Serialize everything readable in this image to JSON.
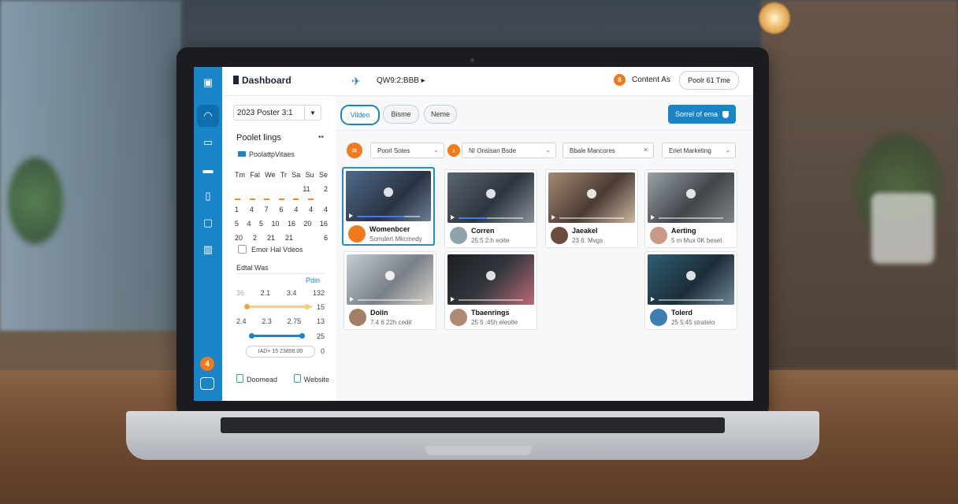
{
  "sidebar_rail": {
    "badge": "4"
  },
  "sidebar": {
    "title": "Dashboard",
    "period": "2023 Poster 3:1",
    "section_title": "Poolet lings",
    "section_more": "••",
    "legend_label": "PoolattpVitaes",
    "calendar": {
      "days": [
        "Tm",
        "Fal",
        "We",
        "Tr",
        "Sa",
        "Su",
        "Se"
      ],
      "rows": [
        [
          "",
          "",
          "",
          "",
          "",
          "11",
          "2"
        ],
        [
          "1",
          "4",
          "7",
          "6",
          "4",
          "4",
          "4"
        ],
        [
          "5",
          "4",
          "5",
          "10",
          "16",
          "20",
          "16"
        ],
        [
          "20",
          "2",
          "21",
          "21",
          "",
          "",
          "6"
        ]
      ]
    },
    "check_label": "Emor Hal Vdeos",
    "filter_title": "Edtal Was",
    "filter_link": "Pdin",
    "range_rows": [
      [
        "36",
        "2.1",
        "3.4",
        "132"
      ],
      [
        "",
        "",
        "",
        "15"
      ],
      [
        "2.4",
        "2.3",
        "2.75",
        "13"
      ],
      [
        "",
        "",
        "",
        "25"
      ]
    ],
    "range_input": "IAD+ 15 23856.00",
    "range_zero": "0",
    "links": [
      "Doomead",
      "Website"
    ]
  },
  "topbar": {
    "crumb": "QW9:2:BBB ▸",
    "badge": "8",
    "label": "Content As",
    "button": "Poolr 61 Tme"
  },
  "tabs": [
    "Vildeo",
    "Bisme",
    "Neme"
  ],
  "cta": "Sorrel of ema",
  "filters": [
    "Poorl Sotes",
    "NI Onsisan Bsde",
    "Bbale Mancores",
    "Eriet Marketing"
  ],
  "cards": [
    {
      "title": "Womenbcer",
      "sub": "Somdert Mkcmedy",
      "selected": true
    },
    {
      "title": "Corren",
      "sub": "25:5 2:h eoite"
    },
    {
      "title": "Jaeakel",
      "sub": "23 6: Mvgs"
    },
    {
      "title": "Aerting",
      "sub": "5 m Mux 0K beset"
    },
    {
      "title": "Doiin",
      "sub": "7.4 6 22h cedit"
    },
    {
      "title": "Tbaenrings",
      "sub": "25 5 :45h eleotle"
    },
    {
      "title": "Tolerd",
      "sub": "25 5:45 stratelo"
    }
  ],
  "colors": {
    "accent": "#1a84c9",
    "orange": "#f07a1c"
  }
}
